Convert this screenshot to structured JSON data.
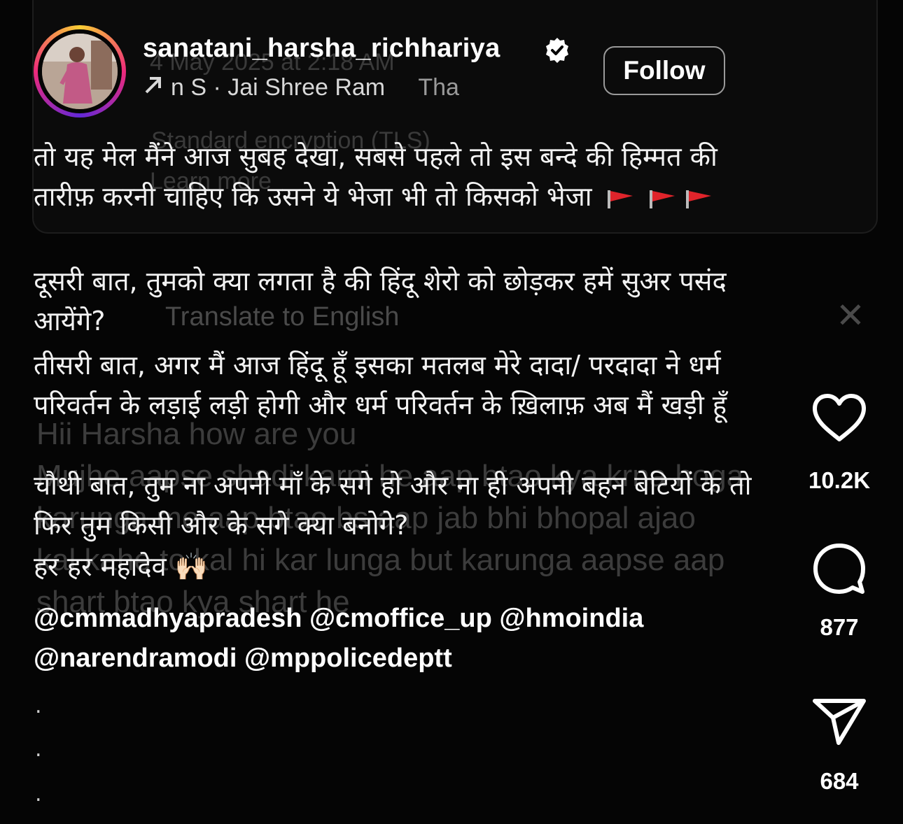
{
  "background": {
    "date": "4 May 2025 at 2:18 AM",
    "encryption": "Standard encryption (TLS)",
    "learn_more": "Learn more",
    "translate": "Translate to English",
    "close_symbol": "✕",
    "message_lines": [
      "Hii Harsha  how are you",
      "Mujhe aapse shadi karni he aap btao kya krna hoga",
      "karunga me aap btao bs aap jab bhi bhopal ajao",
      "kal kahe to kal hi kar lunga  but karunga aapse aap",
      "shart btao kya shart he"
    ]
  },
  "header": {
    "username": "sanatani_harsha_richhariya",
    "verified": true,
    "audio_icon": "arrow-up-right-icon",
    "audio_text": "n S · Jai Shree Ram",
    "audio_text_faded": "Tha",
    "follow_label": "Follow"
  },
  "caption": {
    "p1": "तो यह मेल मैंने आज सुबह देखा, सबसे पहले तो इस बन्दे की हिम्मत की तारीफ़ करनी चाहिए कि उसने ये भेजा भी तो किसको भेजा",
    "p2": "दूसरी बात, तुमको क्या लगता है की हिंदू शेरो को छोड़कर हमें सुअर पसंद आयेंगे?",
    "p3": "तीसरी बात, अगर मैं आज हिंदू हूँ इसका मतलब मेरे दादा/ परदादा ने धर्म परिवर्तन के लड़ाई लड़ी होगी और धर्म परिवर्तन के ख़िलाफ़ अब मैं खड़ी हूँ",
    "p4": "चौथी बात, तुम ना अपनी माँ के सगे हो और ना ही अपनी बहन बेटियों के तो फिर तुम किसी और के सगे क्या बनोगे?",
    "p5": "हर हर महादेव",
    "p5_emoji": "🙌🏻",
    "flag_icon": "red-flag-icon",
    "mentions_line1": "@cmmadhyapradesh @cmoffice_up @hmoindia",
    "mentions_line2": "@narendramodi @mppolicedeptt",
    "dots": [
      ".",
      ".",
      "."
    ]
  },
  "actions": {
    "like_icon": "heart-icon",
    "likes": "10.2K",
    "comment_icon": "comment-bubble-icon",
    "comments": "877",
    "share_icon": "paper-plane-icon",
    "shares": "684"
  },
  "colors": {
    "background": "#050505",
    "text": "#ffffff",
    "flag": "#e0242b",
    "verified_badge": "#ffffff"
  }
}
